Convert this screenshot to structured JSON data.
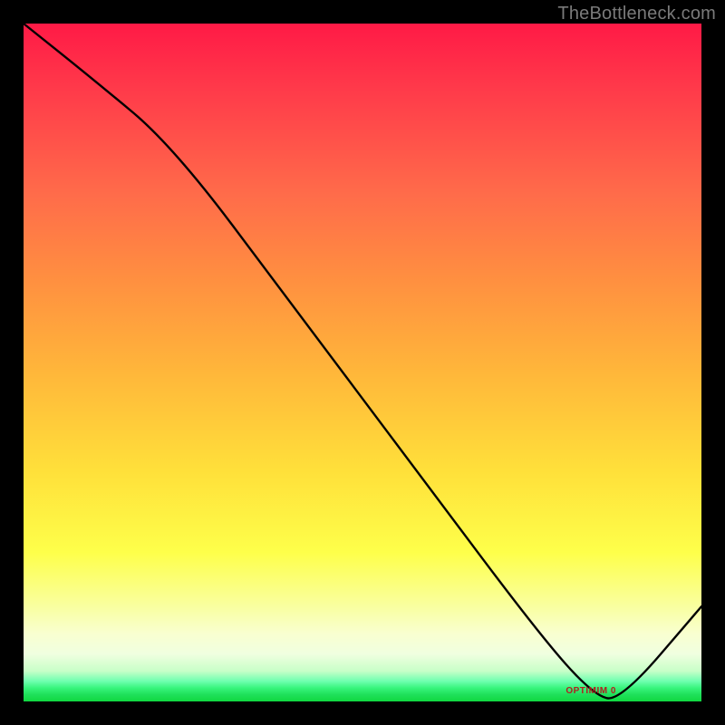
{
  "watermark": "TheBottleneck.com",
  "valley_label": "OPTIMIM 0",
  "chart_data": {
    "type": "line",
    "title": "",
    "xlabel": "",
    "ylabel": "",
    "xlim": [
      0,
      100
    ],
    "ylim": [
      0,
      100
    ],
    "grid": false,
    "background_gradient": {
      "direction": "vertical",
      "stops": [
        {
          "pos": 0,
          "color": "#ff1a46",
          "meaning": "severe"
        },
        {
          "pos": 50,
          "color": "#ffc040",
          "meaning": "moderate"
        },
        {
          "pos": 88,
          "color": "#f8ff90",
          "meaning": "mild"
        },
        {
          "pos": 100,
          "color": "#18d848",
          "meaning": "optimal"
        }
      ]
    },
    "series": [
      {
        "name": "bottleneck-curve",
        "x": [
          0,
          10,
          22,
          40,
          58,
          76,
          84,
          88,
          100
        ],
        "y": [
          100,
          92,
          82,
          58,
          34,
          10,
          1,
          0,
          14
        ],
        "note": "y is percent-of-vertical from bottom; curve descends from top-left, reaches 0 at ~x=84–88 (optimal valley), then rises toward bottom-right."
      }
    ],
    "annotations": [
      {
        "text_ref": "valley_label",
        "x": 84,
        "y": 1.5
      }
    ]
  }
}
